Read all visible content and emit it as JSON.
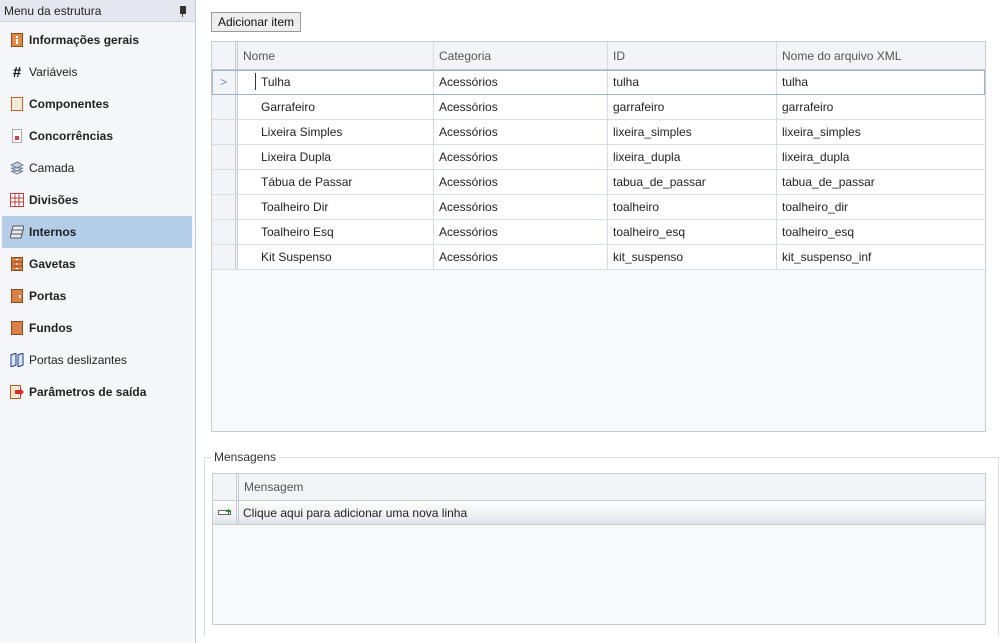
{
  "sidebar": {
    "title": "Menu da estrutura",
    "items": [
      {
        "label": "Informações gerais",
        "icon": "info-panel-icon",
        "bold": true,
        "active": false
      },
      {
        "label": "Variáveis",
        "icon": "hash-icon",
        "bold": false,
        "active": false
      },
      {
        "label": "Componentes",
        "icon": "component-icon",
        "bold": true,
        "active": false
      },
      {
        "label": "Concorrências",
        "icon": "concurrency-icon",
        "bold": true,
        "active": false
      },
      {
        "label": "Camada",
        "icon": "layers-icon",
        "bold": false,
        "active": false
      },
      {
        "label": "Divisões",
        "icon": "grid-divisions-icon",
        "bold": true,
        "active": false
      },
      {
        "label": "Internos",
        "icon": "shelf-icon",
        "bold": true,
        "active": true
      },
      {
        "label": "Gavetas",
        "icon": "drawers-icon",
        "bold": true,
        "active": false
      },
      {
        "label": "Portas",
        "icon": "door-icon",
        "bold": true,
        "active": false
      },
      {
        "label": "Fundos",
        "icon": "back-panel-icon",
        "bold": true,
        "active": false
      },
      {
        "label": "Portas deslizantes",
        "icon": "sliding-door-icon",
        "bold": false,
        "active": false
      },
      {
        "label": "Parâmetros de saída",
        "icon": "export-icon",
        "bold": true,
        "active": false
      }
    ]
  },
  "toolbar": {
    "add_item_label": "Adicionar item"
  },
  "grid": {
    "columns": [
      "Nome",
      "Categoria",
      "ID",
      "Nome do arquivo XML"
    ],
    "current_row_marker": ">",
    "rows": [
      {
        "nome": "Tulha",
        "categoria": "Acessórios",
        "id": "tulha",
        "xml": "tulha"
      },
      {
        "nome": "Garrafeiro",
        "categoria": "Acessórios",
        "id": "garrafeiro",
        "xml": "garrafeiro"
      },
      {
        "nome": "Lixeira Simples",
        "categoria": "Acessórios",
        "id": "lixeira_simples",
        "xml": "lixeira_simples"
      },
      {
        "nome": "Lixeira Dupla",
        "categoria": "Acessórios",
        "id": "lixeira_dupla",
        "xml": "lixeira_dupla"
      },
      {
        "nome": "Tábua de Passar",
        "categoria": "Acessórios",
        "id": "tabua_de_passar",
        "xml": "tabua_de_passar"
      },
      {
        "nome": "Toalheiro Dir",
        "categoria": "Acessórios",
        "id": "toalheiro",
        "xml": "toalheiro_dir"
      },
      {
        "nome": "Toalheiro Esq",
        "categoria": "Acessórios",
        "id": "toalheiro_esq",
        "xml": "toalheiro_esq"
      },
      {
        "nome": "Kit Suspenso",
        "categoria": "Acessórios",
        "id": "kit_suspenso",
        "xml": "kit_suspenso_inf"
      }
    ]
  },
  "messages": {
    "legend": "Mensagens",
    "column": "Mensagem",
    "new_row_text": "Clique aqui para adicionar uma nova linha"
  },
  "colors": {
    "active_item_bg": "#b4cde8",
    "sidebar_bg": "#f5f7fa",
    "icon_wood": "#d9824a"
  }
}
